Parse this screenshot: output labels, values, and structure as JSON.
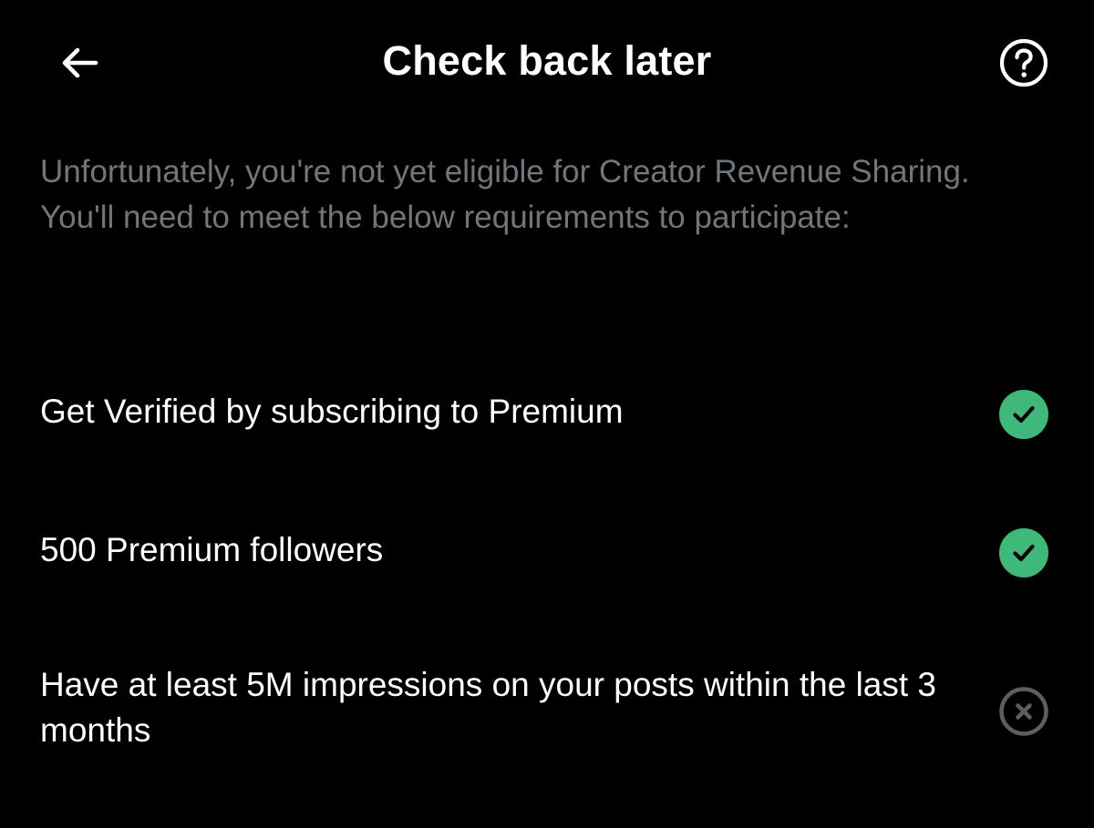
{
  "header": {
    "title": "Check back later",
    "back_icon": "arrow-left-icon",
    "help_icon": "question-circle-icon"
  },
  "description": "Unfortunately, you're not yet eligible for Creator Revenue Sharing. You'll need to meet the below requirements to participate:",
  "requirements": [
    {
      "label": "Get Verified by subscribing to Premium",
      "met": true,
      "icon": "check-circle-icon"
    },
    {
      "label": "500 Premium followers",
      "met": true,
      "icon": "check-circle-icon"
    },
    {
      "label": "Have at least 5M impressions on your posts within the last 3 months",
      "met": false,
      "icon": "x-circle-icon"
    }
  ],
  "colors": {
    "background": "#000000",
    "title": "#ffffff",
    "secondary_text": "#71767b",
    "success": "#3fb979",
    "unmet": "#5b5f63"
  }
}
